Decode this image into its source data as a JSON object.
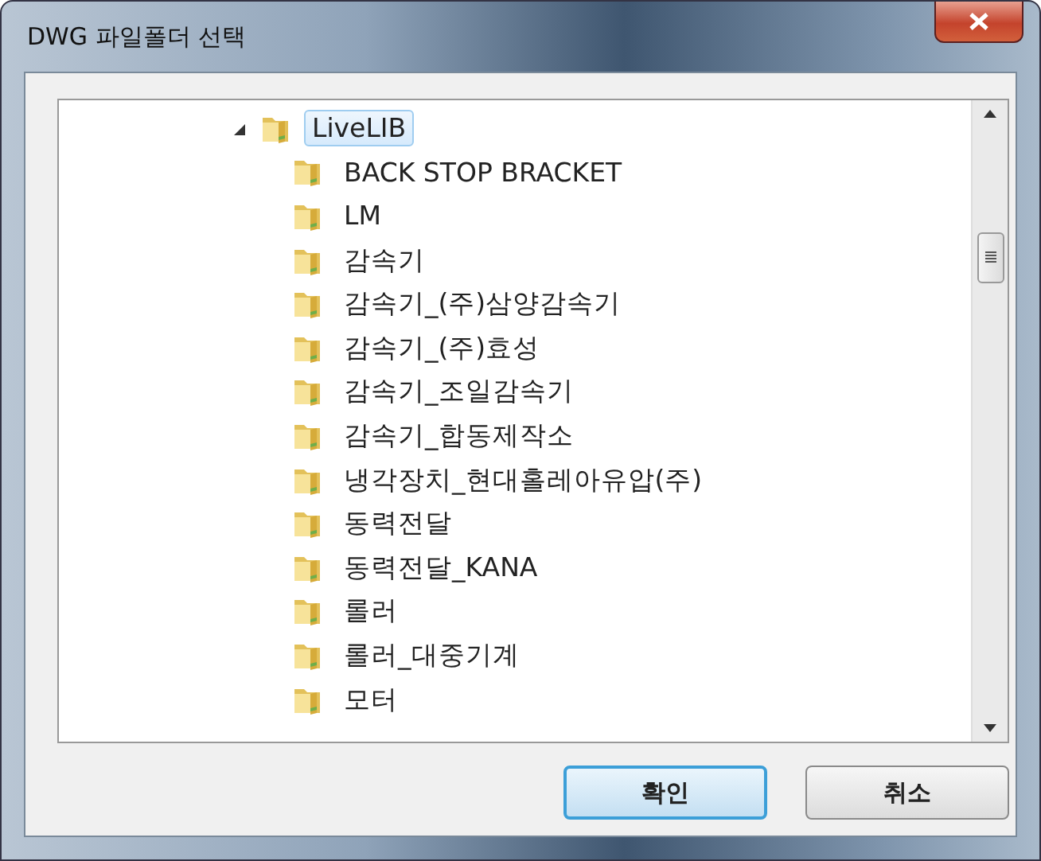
{
  "window": {
    "title": "DWG 파일폴더 선택"
  },
  "tree": {
    "label": "LiveLIB",
    "expanded": true,
    "selected": true,
    "children": [
      {
        "label": "BACK STOP BRACKET"
      },
      {
        "label": "LM"
      },
      {
        "label": "감속기"
      },
      {
        "label": "감속기_(주)삼양감속기"
      },
      {
        "label": "감속기_(주)효성"
      },
      {
        "label": "감속기_조일감속기"
      },
      {
        "label": "감속기_합동제작소"
      },
      {
        "label": "냉각장치_현대홀레아유압(주)"
      },
      {
        "label": "동력전달"
      },
      {
        "label": "동력전달_KANA"
      },
      {
        "label": "롤러"
      },
      {
        "label": "롤러_대중기계"
      },
      {
        "label": "모터"
      }
    ]
  },
  "buttons": [
    {
      "label": "확인",
      "default": true
    },
    {
      "label": "취소",
      "default": false
    }
  ]
}
